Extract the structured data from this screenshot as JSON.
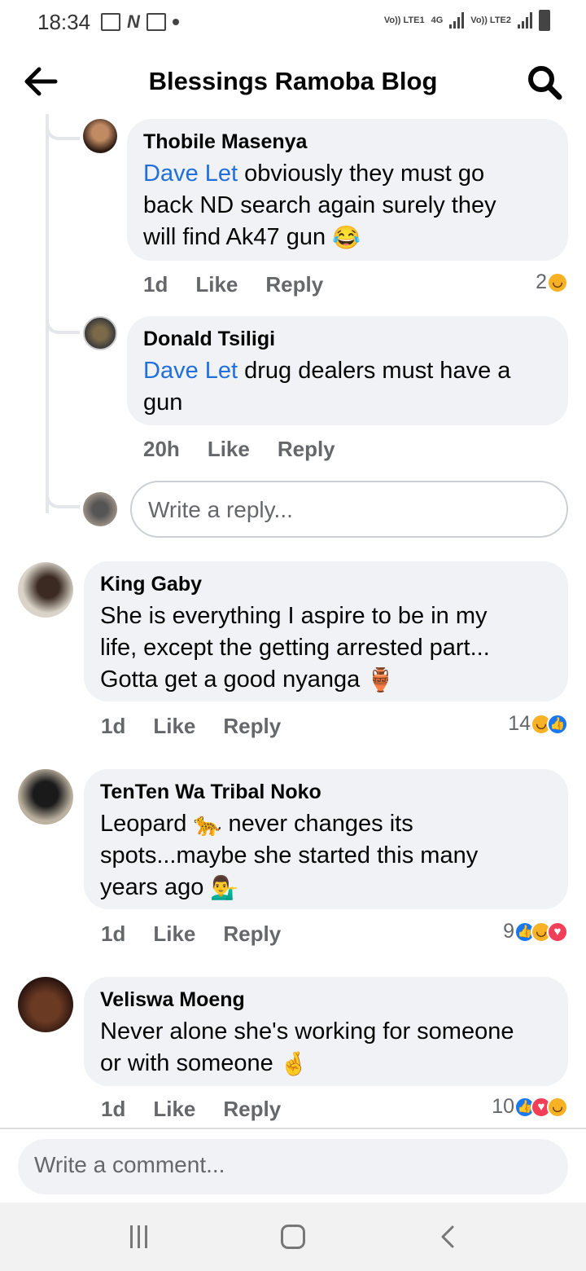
{
  "status_bar": {
    "time": "18:34",
    "sim1_label": "Vo)) LTE1",
    "net_label": "4G",
    "sim2_label": "Vo)) LTE2"
  },
  "header": {
    "title": "Blessings Ramoba Blog",
    "back_icon": "arrow-left-icon",
    "search_icon": "search-icon"
  },
  "replies": [
    {
      "name": "Thobile Masenya",
      "mention": "Dave Let",
      "lines": [
        "obviously they must go",
        "back ND search again surely they",
        "will find Ak47 gun"
      ],
      "emoji": "😂",
      "time": "1d",
      "like": "Like",
      "reply": "Reply",
      "reaction_count": "2",
      "reactions": [
        "haha-icon"
      ]
    },
    {
      "name": "Donald Tsiligi",
      "mention": "Dave Let",
      "lines": [
        "drug dealers must have a",
        "gun"
      ],
      "time": "20h",
      "like": "Like",
      "reply": "Reply"
    }
  ],
  "reply_placeholder": "Write a reply...",
  "comments": [
    {
      "name": "King Gaby",
      "lines": [
        "She is everything I aspire to be in my",
        "life, except the getting arrested part...",
        "Gotta get a good nyanga"
      ],
      "emoji": "🏺",
      "time": "1d",
      "like": "Like",
      "reply": "Reply",
      "reaction_count": "14",
      "reactions": [
        "haha-icon",
        "like-icon"
      ]
    },
    {
      "name": "TenTen Wa Tribal Noko",
      "lines": [
        "Leopard",
        "never changes its",
        "spots...maybe she started this many",
        "years ago"
      ],
      "emoji1": "🐆",
      "emoji2": "💁‍♂️",
      "time": "1d",
      "like": "Like",
      "reply": "Reply",
      "reaction_count": "9",
      "reactions": [
        "like-icon",
        "haha-icon",
        "love-icon"
      ]
    },
    {
      "name": "Veliswa Moeng",
      "lines": [
        "Never alone she's working for someone",
        "or with someone"
      ],
      "emoji": "🤞",
      "time": "1d",
      "like": "Like",
      "reply": "Reply",
      "reaction_count": "10",
      "reactions": [
        "like-icon",
        "love-icon",
        "haha-icon"
      ]
    }
  ],
  "comment_placeholder": "Write a comment...",
  "colors": {
    "mention": "#216fdb",
    "bubble": "#f0f2f5",
    "like": "#1877f2",
    "love": "#f33e58",
    "haha": "#f7b125"
  }
}
